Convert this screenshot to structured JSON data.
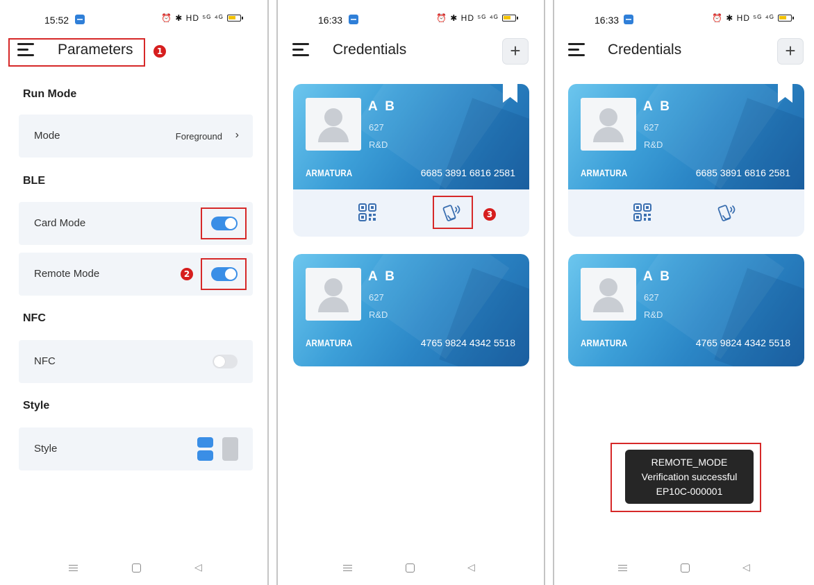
{
  "panels": [
    {
      "status": {
        "time": "15:52",
        "icons": "⏰ ✱ HD ⁵ᴳ ⁴ᴳ"
      },
      "header": {
        "title": "Parameters"
      },
      "sections": [
        {
          "title": "Run Mode",
          "rows": [
            {
              "label": "Mode",
              "value": "Foreground"
            }
          ]
        },
        {
          "title": "BLE",
          "rows": [
            {
              "label": "Card Mode",
              "toggle": true
            },
            {
              "label": "Remote Mode",
              "toggle": true
            }
          ]
        },
        {
          "title": "NFC",
          "rows": [
            {
              "label": "NFC",
              "toggle": false
            }
          ]
        },
        {
          "title": "Style",
          "rows": [
            {
              "label": "Style"
            }
          ]
        }
      ],
      "annotations": {
        "b1": "1",
        "b2": "2"
      }
    },
    {
      "status": {
        "time": "16:33",
        "icons": "⏰ ✱ HD ⁵ᴳ ⁴ᴳ"
      },
      "header": {
        "title": "Credentials",
        "add": "+"
      },
      "cards": [
        {
          "name": "A B",
          "id": "627",
          "dept": "R&D",
          "brand": "ARMATURA",
          "number": "6685 3891 6816 2581"
        },
        {
          "name": "A B",
          "id": "627",
          "dept": "R&D",
          "brand": "ARMATURA",
          "number": "4765 9824 4342 5518"
        }
      ],
      "annotations": {
        "b3": "3"
      }
    },
    {
      "status": {
        "time": "16:33",
        "icons": "⏰ ✱ HD ⁵ᴳ ⁴ᴳ"
      },
      "header": {
        "title": "Credentials",
        "add": "+"
      },
      "cards": [
        {
          "name": "A B",
          "id": "627",
          "dept": "R&D",
          "brand": "ARMATURA",
          "number": "6685 3891 6816 2581"
        },
        {
          "name": "A B",
          "id": "627",
          "dept": "R&D",
          "brand": "ARMATURA",
          "number": "4765 9824 4342 5518"
        }
      ],
      "toast": {
        "line1": "REMOTE_MODE",
        "line2": "Verification successful",
        "line3": "EP10C-000001"
      }
    }
  ],
  "colors": {
    "accent": "#3a8ee6",
    "highlight": "#d62828",
    "card_dark": "#1e66a8",
    "card_light": "#6cc6ee"
  },
  "icons": [
    "menu-icon",
    "chevron-right-icon",
    "toggle-switch",
    "qr-code-icon",
    "nfc-phone-icon",
    "bookmark-icon",
    "plus-icon",
    "avatar-placeholder-icon"
  ]
}
